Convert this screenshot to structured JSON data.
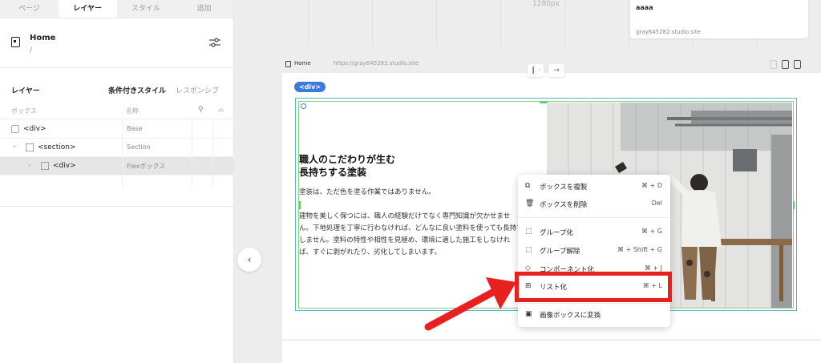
{
  "tabs": [
    {
      "label": "ページ"
    },
    {
      "label": "レイヤー"
    },
    {
      "label": "スタイル"
    },
    {
      "label": "追加"
    }
  ],
  "page": {
    "title": "Home",
    "path": "/"
  },
  "layers_panel": {
    "title": "レイヤー",
    "conditional_style": "条件付きスタイル",
    "responsive": "レスポンシブ",
    "col_box": "ボックス",
    "col_name": "名称",
    "rows": [
      {
        "label": "<div>",
        "name": "Base"
      },
      {
        "label": "<section>",
        "name": "Section"
      },
      {
        "label": "<div>",
        "name": "Flexボックス"
      }
    ]
  },
  "canvas": {
    "ruler_label": "1280px",
    "card_title": "aaaa",
    "card_url": "gray645282.studio.site",
    "frame_label": "Home",
    "frame_url": "https://gray645282.studio.site",
    "div_tag": "<div>",
    "heading_line1": "職人のこだわりが生む",
    "heading_line2": "長持ちする塗装",
    "para1": "塗装は、ただ色を塗る作業ではありません。",
    "para2": "建物を美しく保つには、職人の経験だけでなく専門知識が欠かせません。下地処理を丁寧に行わなければ、どんなに良い塗料を使っても長持ちしません。塗料の特性や相性を見極め、環境に適した施工をしなければ、すぐに剥がれたり、劣化してしまいます。"
  },
  "context_menu": {
    "items": [
      {
        "label": "ボックスを複製",
        "shortcut": "⌘ + D",
        "icon": "duplicate-icon"
      },
      {
        "label": "ボックスを削除",
        "shortcut": "Del",
        "icon": "trash-icon"
      },
      {
        "label": "グループ化",
        "shortcut": "⌘ + G",
        "icon": "group-icon"
      },
      {
        "label": "グループ解除",
        "shortcut": "⌘ + Shift + G",
        "icon": "ungroup-icon"
      },
      {
        "label": "コンポーネント化",
        "shortcut": "⌘ + J",
        "icon": "component-icon"
      },
      {
        "label": "リスト化",
        "shortcut": "⌘ + L",
        "icon": "list-grid-icon"
      },
      {
        "label": "画像ボックスに変換",
        "shortcut": "",
        "icon": "image-icon"
      }
    ]
  },
  "colors": {
    "accent": "#3b7be0",
    "highlight": "#e8211e",
    "selection": "#5bb8c2"
  }
}
